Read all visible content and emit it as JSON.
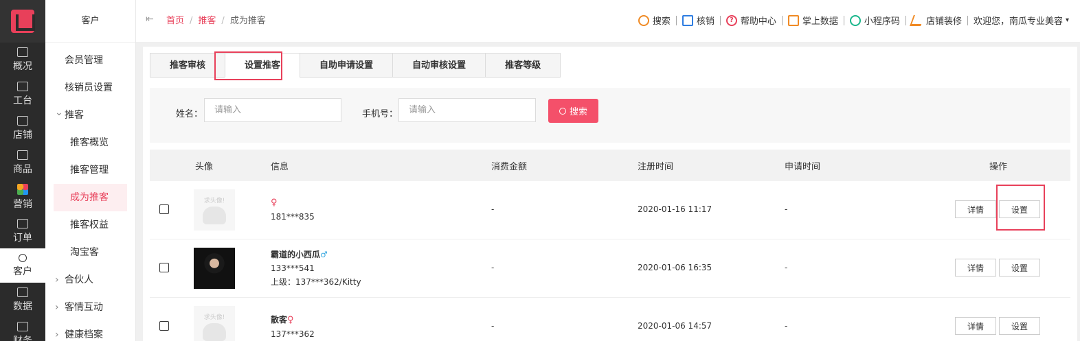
{
  "rail": {
    "items": [
      {
        "label": "概况",
        "icon": "dashboard-icon"
      },
      {
        "label": "工台",
        "icon": "monitor-icon"
      },
      {
        "label": "店铺",
        "icon": "store-icon"
      },
      {
        "label": "商品",
        "icon": "bag-icon"
      },
      {
        "label": "营销",
        "icon": "marketing-icon"
      },
      {
        "label": "订单",
        "icon": "order-icon"
      },
      {
        "label": "客户",
        "icon": "user-icon"
      },
      {
        "label": "数据",
        "icon": "data-icon"
      },
      {
        "label": "财务",
        "icon": "finance-icon"
      }
    ]
  },
  "sidebar": {
    "title": "客户",
    "items": [
      {
        "label": "会员管理"
      },
      {
        "label": "核销员设置"
      },
      {
        "label": "推客"
      },
      {
        "label": "推客概览"
      },
      {
        "label": "推客管理"
      },
      {
        "label": "成为推客"
      },
      {
        "label": "推客权益"
      },
      {
        "label": "淘宝客"
      },
      {
        "label": "合伙人"
      },
      {
        "label": "客情互动"
      },
      {
        "label": "健康档案"
      }
    ]
  },
  "breadcrumb": {
    "home": "首页",
    "parent": "推客",
    "sep": "/",
    "current": "成为推客"
  },
  "toolbar": {
    "search": "搜索",
    "verify": "核销",
    "help": "帮助中心",
    "data": "掌上数据",
    "mini": "小程序码",
    "decorate": "店铺装修",
    "welcome": "欢迎您，南瓜专业美容",
    "help_glyph": "?",
    "caret": "▾"
  },
  "tabs": [
    {
      "label": "推客审核"
    },
    {
      "label": "设置推客"
    },
    {
      "label": "自助申请设置"
    },
    {
      "label": "自动审核设置"
    },
    {
      "label": "推客等级"
    }
  ],
  "filter": {
    "name_label": "姓名：",
    "name_placeholder": "请输入",
    "phone_label": "手机号：",
    "phone_placeholder": "请输入",
    "search_button": "搜索"
  },
  "table": {
    "headers": {
      "avatar": "头像",
      "info": "信息",
      "spend": "消费金额",
      "registered": "注册时间",
      "applied": "申请时间",
      "ops": "操作"
    },
    "avatar_placeholder": "求头像!",
    "detail_label": "详情",
    "set_label": "设置",
    "rows": [
      {
        "name": "",
        "gender": "♀",
        "phone": "181***835",
        "parent": "",
        "spend": "-",
        "registered": "2020-01-16 11:17",
        "applied": "-"
      },
      {
        "name": "霸道的小西瓜",
        "gender": "♂",
        "phone": "133***541",
        "parent": "上级：137***362/Kitty",
        "spend": "-",
        "registered": "2020-01-06 16:35",
        "applied": "-"
      },
      {
        "name": "散客",
        "gender": "♀",
        "phone": "137***362",
        "parent": "",
        "spend": "-",
        "registered": "2020-01-06 14:57",
        "applied": "-"
      }
    ]
  },
  "colors": {
    "accent": "#e8405a",
    "button": "#f4506a",
    "rail": "#2b2b2b"
  }
}
